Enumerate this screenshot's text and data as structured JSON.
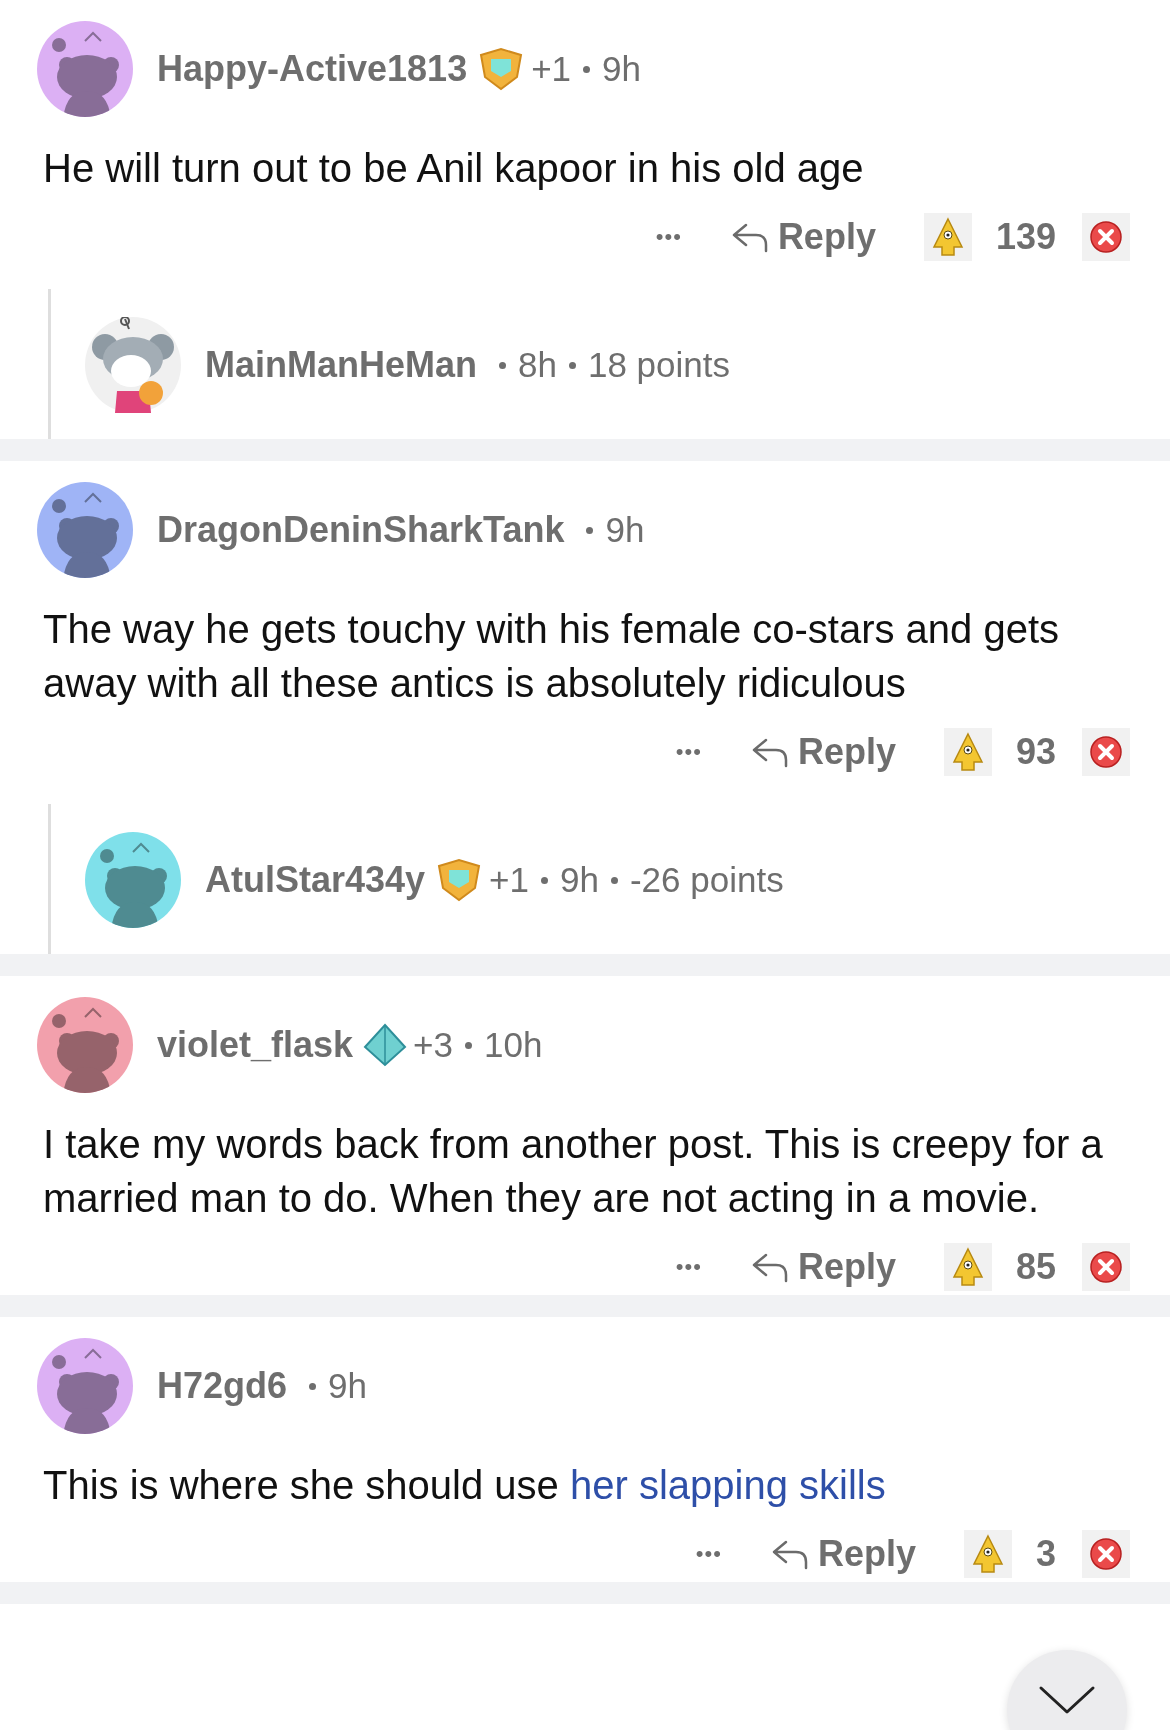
{
  "comments": [
    {
      "avatar": {
        "kind": "snoo",
        "color": "#dcb0f4"
      },
      "username": "Happy-Active1813",
      "award": {
        "kind": "shield",
        "count": "+1"
      },
      "time": "9h",
      "body": "He will turn out to be Anil kapoor in his old age",
      "actions": {
        "more": "•••",
        "reply": "Reply",
        "score": "139"
      },
      "reply": {
        "avatar": {
          "kind": "koala",
          "color": "#f0f0f0"
        },
        "username": "MainManHeMan",
        "time": "8h",
        "points": "18 points"
      }
    },
    {
      "avatar": {
        "kind": "snoo",
        "color": "#9fb4f6"
      },
      "username": "DragonDeninSharkTank",
      "time": "9h",
      "body": "The way he gets touchy with his female co-stars and gets away with all these antics is absolutely ridiculous",
      "actions": {
        "more": "•••",
        "reply": "Reply",
        "score": "93"
      },
      "reply": {
        "avatar": {
          "kind": "snoo",
          "color": "#7fe0ea"
        },
        "username": "AtulStar434y",
        "award": {
          "kind": "shield",
          "count": "+1"
        },
        "time": "9h",
        "points": "-26 points"
      }
    },
    {
      "avatar": {
        "kind": "snoo",
        "color": "#f2a0ac"
      },
      "username": "violet_flask",
      "award": {
        "kind": "pyramid",
        "count": "+3"
      },
      "time": "10h",
      "body": "I take my words back from another post. This is creepy for a married man to do. When they are not acting in a movie.",
      "actions": {
        "more": "•••",
        "reply": "Reply",
        "score": "85"
      }
    },
    {
      "avatar": {
        "kind": "snoo",
        "color": "#dcb0f4"
      },
      "username": "H72gd6",
      "time": "9h",
      "body": "This is where she should use",
      "link": "her slapping skills",
      "actions": {
        "more": "•••",
        "reply": "Reply",
        "score": "3"
      }
    }
  ]
}
